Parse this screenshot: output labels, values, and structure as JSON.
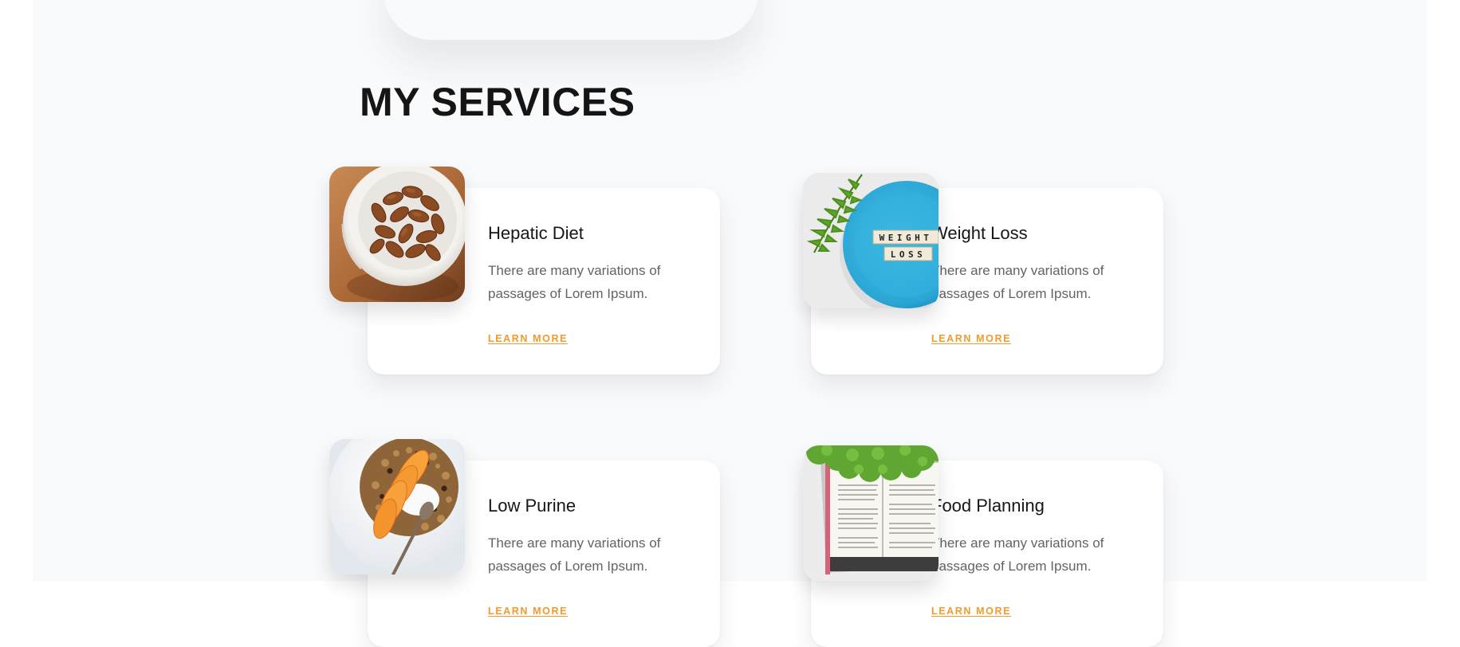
{
  "section": {
    "title": "MY SERVICES"
  },
  "services": [
    {
      "title": "Hepatic Diet",
      "description": "There are many variations of passages of Lorem Ipsum.",
      "link_label": "LEARN MORE",
      "image_icon": "almonds-bowl-photo"
    },
    {
      "title": "Weight Loss",
      "description": "There are many variations of passages of Lorem Ipsum.",
      "link_label": "LEARN MORE",
      "image_icon": "weight-loss-plate-photo",
      "image_text": [
        "WEIGHT",
        "LOSS"
      ]
    },
    {
      "title": "Low Purine",
      "description": "There are many variations of passages of Lorem Ipsum.",
      "link_label": "LEARN MORE",
      "image_icon": "peach-granola-bowl-photo"
    },
    {
      "title": "Food Planning",
      "description": "There are many variations of passages of Lorem Ipsum.",
      "link_label": "LEARN MORE",
      "image_icon": "open-cookbook-kale-photo"
    }
  ],
  "colors": {
    "page_background": "#f9fafc",
    "heading": "#151515",
    "body_text": "#636363",
    "accent": "#f39a2c",
    "card_background": "#ffffff"
  }
}
